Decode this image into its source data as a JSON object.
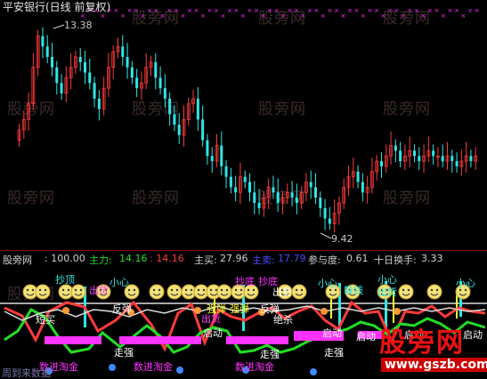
{
  "chart_title": "平安银行(日线 前复权)",
  "price_high_label": "13.38",
  "price_low_label": "9.42",
  "indicator": {
    "name": "股旁网",
    "value": ": 100.00",
    "main_force_label": "主力:",
    "main_force_value": "14.16",
    "neg_value": ": 14.16",
    "buy_label": "主买:",
    "buy_value": "27.96",
    "sell_label": "主卖:",
    "sell_value": "17.79",
    "participation_label": "参与度:",
    "participation_value": "0.61",
    "turnover_label": "十日换手:",
    "turnover_value": "3.33"
  },
  "signals": [
    "抄顶",
    "出货",
    "小心",
    "短买",
    "反弹",
    "抄底",
    "抄底",
    "强弹",
    "反弹",
    "出货",
    "绝杀",
    "强弹",
    "出货",
    "小心",
    "躲钱",
    "小心",
    "出货",
    "小心",
    "启动",
    "走强",
    "数进淘金",
    "启动",
    "走强",
    "数进淘金",
    "启动",
    "走强",
    "数进淘金",
    "启动",
    "启动"
  ],
  "watermarks": [
    "股旁网",
    "股旁网",
    "股旁网",
    "股旁网",
    "股旁网",
    "股旁网",
    "股旁网",
    "股旁网",
    "股旁网",
    "股旁网",
    "股旁网",
    "股旁网"
  ],
  "logo_text": "股旁网",
  "logo_url": "www.gszb.com",
  "footer_text": "周到来数据",
  "colors": {
    "bg": "#000000",
    "up": "#ff3b3b",
    "down": "#2ee6e6",
    "main_force": "#22dd22",
    "sell": "#4a4aff",
    "magenta": "#ff33ff",
    "yellow": "#ffff33"
  },
  "chart_data": {
    "type": "candlestick",
    "title": "平安银行(日线 前复权)",
    "max_price": 13.38,
    "min_price": 9.42,
    "closes": [
      11.4,
      11.6,
      11.9,
      12.6,
      13.2,
      13.0,
      12.8,
      12.6,
      12.3,
      12.1,
      12.4,
      12.6,
      12.8,
      12.7,
      12.5,
      12.3,
      12.0,
      11.8,
      12.2,
      12.6,
      12.9,
      13.0,
      12.8,
      12.6,
      12.4,
      12.2,
      12.3,
      12.6,
      12.7,
      12.4,
      12.2,
      12.0,
      11.7,
      11.5,
      11.3,
      11.6,
      11.9,
      12.0,
      11.6,
      11.2,
      10.9,
      10.8,
      11.1,
      10.7,
      10.5,
      10.3,
      10.2,
      10.5,
      10.4,
      10.2,
      10.0,
      9.9,
      10.1,
      10.3,
      10.2,
      10.0,
      10.1,
      10.2,
      10.1,
      10.0,
      10.2,
      10.4,
      10.3,
      10.1,
      9.9,
      9.7,
      9.6,
      9.8,
      10.0,
      10.3,
      10.5,
      10.6,
      10.4,
      10.2,
      10.3,
      10.6,
      10.8,
      10.7,
      10.9,
      11.1,
      11.0,
      10.8,
      10.9,
      11.0,
      10.9,
      10.8,
      10.9,
      11.0,
      10.9,
      10.9,
      10.8,
      10.9,
      10.8,
      10.7,
      10.8,
      10.9,
      10.8,
      10.9
    ]
  }
}
